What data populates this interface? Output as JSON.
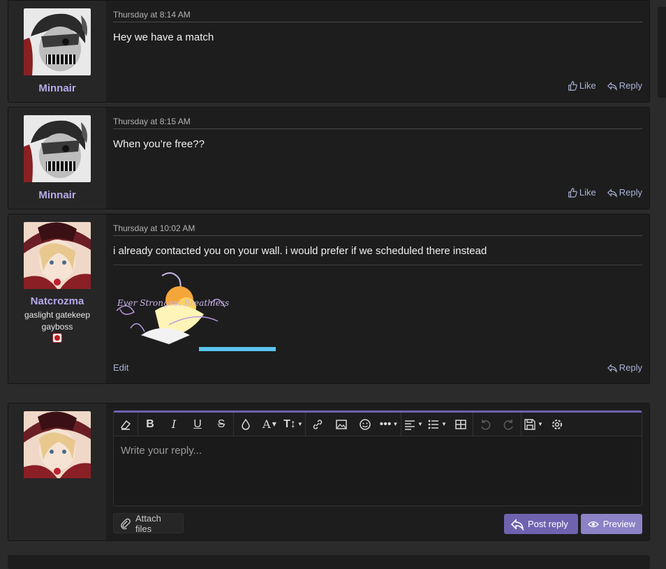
{
  "posts": [
    {
      "username": "Minnair",
      "time": "Thursday at 8:14 AM",
      "message": "Hey we have a match",
      "like_label": "Like",
      "reply_label": "Reply"
    },
    {
      "username": "Minnair",
      "time": "Thursday at 8:15 AM",
      "message": "When you’re free??",
      "like_label": "Like",
      "reply_label": "Reply"
    },
    {
      "username": "Natcrozma",
      "user_title_1": "gaslight gatekeep",
      "user_title_2": "gayboss",
      "time": "Thursday at 10:02 AM",
      "message": "i already contacted you on your wall. i would prefer if we scheduled there instead",
      "edit_label": "Edit",
      "reply_label": "Reply",
      "signature_text": "Ever Strongest Breathless"
    }
  ],
  "editor": {
    "placeholder": "Write your reply...",
    "attach_label": "Attach files",
    "post_reply_label": "Post reply",
    "preview_label": "Preview",
    "toolbar_icons": [
      "eraser-icon",
      "bold-icon",
      "italic-icon",
      "underline-icon",
      "strikethrough-icon",
      "color-drop-icon",
      "font-family-icon",
      "font-size-icon",
      "link-icon",
      "image-icon",
      "emoji-icon",
      "more-icon",
      "align-icon",
      "list-icon",
      "table-icon",
      "undo-icon",
      "redo-icon",
      "drafts-icon",
      "settings-icon"
    ]
  },
  "colors": {
    "accent": "#6f63b0",
    "username": "#b7a9ea",
    "link": "#aab3d6",
    "signature_bar": "#5bc6f0"
  }
}
